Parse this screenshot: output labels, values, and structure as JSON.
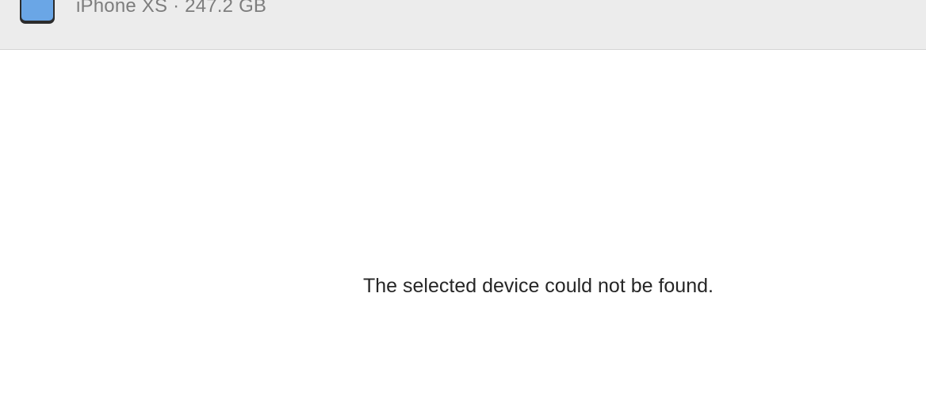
{
  "header": {
    "device_info": "iPhone XS · 247.2 GB",
    "device_icon": "iphone-icon"
  },
  "main": {
    "message": "The selected device could not be found."
  },
  "colors": {
    "header_background": "#ececec",
    "device_screen": "#6aa6e6",
    "message_text": "#262626"
  }
}
